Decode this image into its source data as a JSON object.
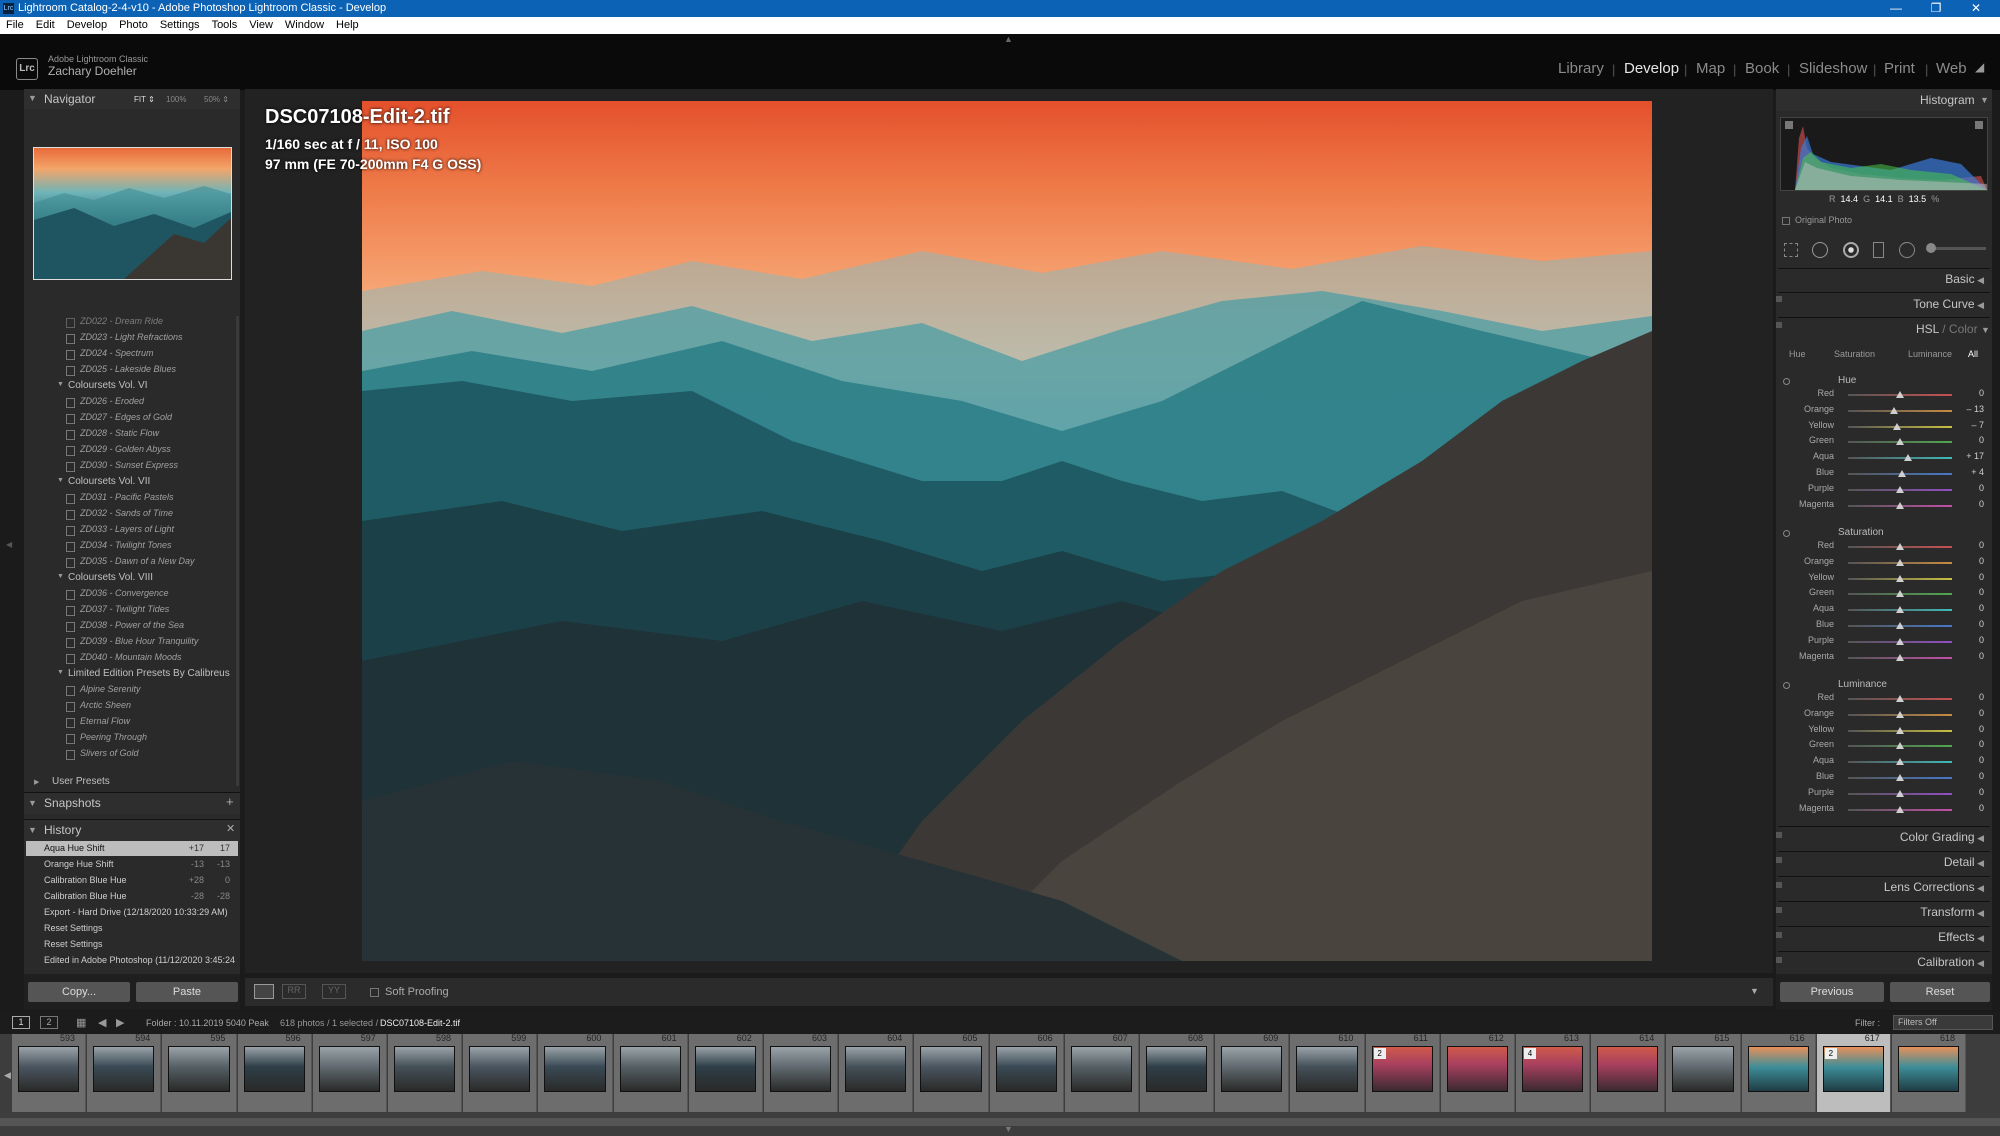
{
  "window": {
    "title": "Lightroom Catalog-2-4-v10 - Adobe Photoshop Lightroom Classic - Develop",
    "controls": [
      "—",
      "❐",
      "✕"
    ]
  },
  "menu": [
    "File",
    "Edit",
    "Develop",
    "Photo",
    "Settings",
    "Tools",
    "View",
    "Window",
    "Help"
  ],
  "identity": {
    "logo": "Lrc",
    "app_name": "Adobe Lightroom Classic",
    "user": "Zachary Doehler"
  },
  "modules": {
    "items": [
      "Library",
      "Develop",
      "Map",
      "Book",
      "Slideshow",
      "Print",
      "Web"
    ],
    "active": "Develop"
  },
  "navigator": {
    "title": "Navigator",
    "zoom_options": [
      "FIT ⇕",
      "100%",
      "50% ⇕"
    ]
  },
  "presets": {
    "groups": [
      {
        "name": "",
        "items": [
          "ZD022 - Dream Ride",
          "ZD023 - Light Refractions",
          "ZD024 - Spectrum",
          "ZD025 - Lakeside Blues"
        ]
      },
      {
        "name": "Coloursets Vol. VI",
        "items": [
          "ZD026 - Eroded",
          "ZD027 - Edges of Gold",
          "ZD028 - Static Flow",
          "ZD029 - Golden Abyss",
          "ZD030 - Sunset Express"
        ]
      },
      {
        "name": "Coloursets Vol. VII",
        "items": [
          "ZD031 - Pacific Pastels",
          "ZD032 - Sands of Time",
          "ZD033 - Layers of Light",
          "ZD034 - Twilight Tones",
          "ZD035 - Dawn of a New Day"
        ]
      },
      {
        "name": "Coloursets Vol. VIII",
        "items": [
          "ZD036 - Convergence",
          "ZD037 - Twilight Tides",
          "ZD038 - Power of the Sea",
          "ZD039 - Blue Hour Tranquility",
          "ZD040 - Mountain Moods"
        ]
      },
      {
        "name": "Limited Edition Presets By Calibreus",
        "items": [
          "Alpine Serenity",
          "Arctic Sheen",
          "Eternal Flow",
          "Peering Through",
          "Slivers of Gold"
        ]
      }
    ],
    "user_presets": "User Presets"
  },
  "snapshots": {
    "title": "Snapshots",
    "add": "+"
  },
  "history": {
    "title": "History",
    "clear": "✕",
    "items": [
      {
        "label": "Aqua Hue Shift",
        "delta": "+17",
        "value": "17",
        "selected": true
      },
      {
        "label": "Orange Hue Shift",
        "delta": "-13",
        "value": "-13"
      },
      {
        "label": "Calibration Blue Hue",
        "delta": "+28",
        "value": "0"
      },
      {
        "label": "Calibration Blue Hue",
        "delta": "-28",
        "value": "-28"
      },
      {
        "label": "Export - Hard Drive (12/18/2020 10:33:29 AM)",
        "delta": "",
        "value": ""
      },
      {
        "label": "Reset Settings",
        "delta": "",
        "value": ""
      },
      {
        "label": "Reset Settings",
        "delta": "",
        "value": ""
      },
      {
        "label": "Edited in Adobe Photoshop (11/12/2020 3:45:24 ...",
        "delta": "",
        "value": ""
      }
    ]
  },
  "left_buttons": {
    "copy": "Copy...",
    "paste": "Paste"
  },
  "photo_info": {
    "filename": "DSC07108-Edit-2.tif",
    "exposure": "1/160 sec at f / 11, ISO 100",
    "lens": "97 mm (FE 70-200mm F4 G OSS)"
  },
  "toolbar": {
    "soft_proofing": "Soft Proofing"
  },
  "histogram": {
    "title": "Histogram",
    "r_label": "R",
    "r": "14.4",
    "g_label": "G",
    "g": "14.1",
    "b_label": "B",
    "b": "13.5",
    "pct": "%",
    "original_photo": "Original Photo"
  },
  "panels": {
    "basic": "Basic",
    "tone_curve": "Tone Curve",
    "hsl": "HSL",
    "hsl_sep": " / ",
    "color": "Color",
    "hsl_tabs": [
      "Hue",
      "Saturation",
      "Luminance",
      "All"
    ],
    "color_grading": "Color Grading",
    "detail": "Detail",
    "lens_corrections": "Lens Corrections",
    "transform": "Transform",
    "effects": "Effects",
    "calibration": "Calibration"
  },
  "hsl": {
    "colors": [
      "Red",
      "Orange",
      "Yellow",
      "Green",
      "Aqua",
      "Blue",
      "Purple",
      "Magenta"
    ],
    "hue_title": "Hue",
    "hue": [
      "0",
      "– 13",
      "– 7",
      "0",
      "+ 17",
      "+ 4",
      "0",
      "0"
    ],
    "hue_fraction": [
      0.5,
      0.44,
      0.47,
      0.5,
      0.58,
      0.52,
      0.5,
      0.5
    ],
    "saturation_title": "Saturation",
    "saturation": [
      "0",
      "0",
      "0",
      "0",
      "0",
      "0",
      "0",
      "0"
    ],
    "luminance_title": "Luminance",
    "luminance": [
      "0",
      "0",
      "0",
      "0",
      "0",
      "0",
      "0",
      "0"
    ],
    "track_colors": [
      "#c85050",
      "#c88a40",
      "#c8c040",
      "#50a850",
      "#40b8b8",
      "#4878c8",
      "#9050c0",
      "#c050a8"
    ]
  },
  "right_buttons": {
    "previous": "Previous",
    "reset": "Reset"
  },
  "filmstrip": {
    "view1": "1",
    "view2": "2",
    "folder": "Folder : 10.11.2019 5040 Peak",
    "count": "618 photos / 1 selected /",
    "selected": "DSC07108-Edit-2.tif",
    "filter_label": "Filter :",
    "filter_value": "Filters Off",
    "numbers": [
      "593",
      "594",
      "595",
      "596",
      "597",
      "598",
      "599",
      "600",
      "601",
      "602",
      "603",
      "604",
      "605",
      "606",
      "607",
      "608",
      "609",
      "610",
      "611",
      "612",
      "613",
      "614",
      "615",
      "616",
      "617",
      "618"
    ],
    "stack_badges": {
      "611": "2",
      "613": "4",
      "617": "2"
    }
  },
  "colors": {
    "title_bar": "#0c63b5",
    "panel_bg": "#2a2a2a",
    "selected_row": "#bdbdbd"
  }
}
